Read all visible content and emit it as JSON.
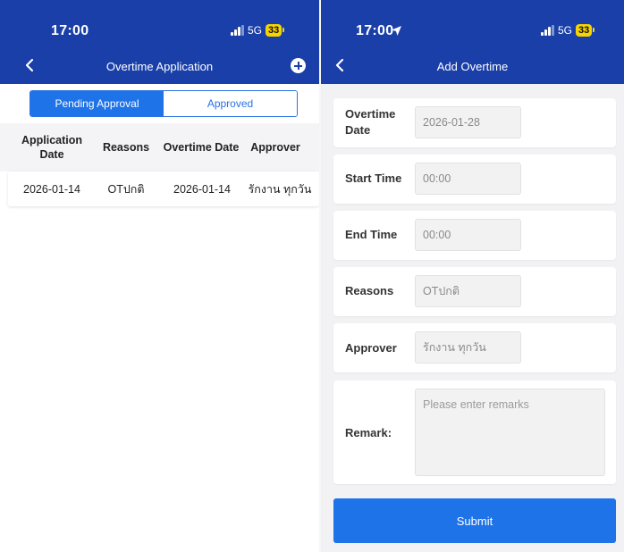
{
  "left_screen": {
    "status": {
      "time": "17:00",
      "network": "5G",
      "battery": "33"
    },
    "nav": {
      "title": "Overtime Application"
    },
    "tabs": [
      {
        "label": "Pending Approval",
        "active": true
      },
      {
        "label": "Approved",
        "active": false
      }
    ],
    "table": {
      "columns": [
        "Application Date",
        "Reasons",
        "Overtime Date",
        "Approver"
      ],
      "rows": [
        {
          "application_date": "2026-01-14",
          "reason": "OTปกติ",
          "overtime_date": "2026-01-14",
          "approver": "รักงาน ทุกวัน"
        }
      ]
    }
  },
  "right_screen": {
    "status": {
      "time": "17:00",
      "network": "5G",
      "battery": "33"
    },
    "nav": {
      "title": "Add Overtime"
    },
    "form": {
      "overtime_date": {
        "label": "Overtime Date",
        "value": "2026-01-28"
      },
      "start_time": {
        "label": "Start Time",
        "value": "00:00"
      },
      "end_time": {
        "label": "End Time",
        "value": "00:00"
      },
      "reasons": {
        "label": "Reasons",
        "value": "OTปกติ"
      },
      "approver": {
        "label": "Approver",
        "value": "รักงาน ทุกวัน"
      },
      "remark": {
        "label": "Remark:",
        "placeholder": "Please enter remarks",
        "value": ""
      }
    },
    "submit_label": "Submit"
  },
  "colors": {
    "header": "#1a3fa8",
    "accent": "#1f73e8",
    "battery": "#f5d400"
  },
  "icons": [
    "back-arrow-icon",
    "add-circle-icon",
    "signal-icon",
    "battery-icon",
    "location-arrow-icon"
  ]
}
